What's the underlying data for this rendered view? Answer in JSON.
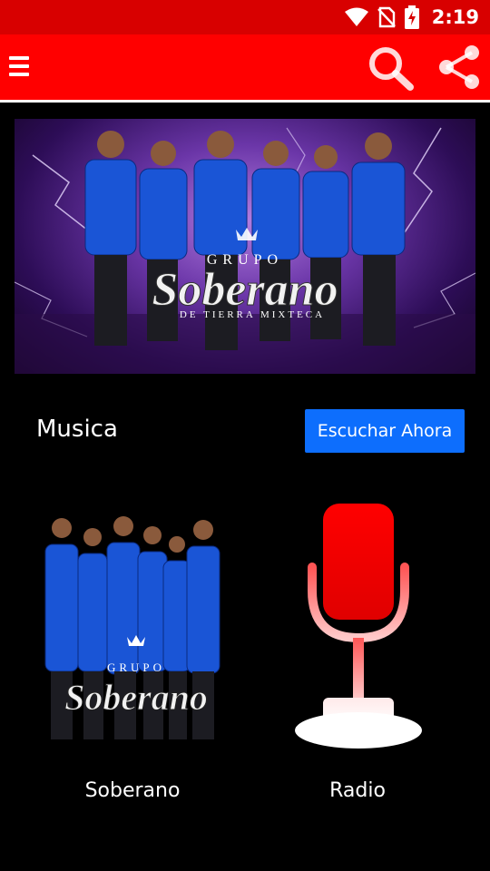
{
  "status_bar": {
    "time": "2:19"
  },
  "app_bar": {
    "menu_icon": "menu-icon",
    "search_icon": "search-icon",
    "share_icon": "share-icon",
    "background": "#ff0000"
  },
  "banner": {
    "logo_top": "GRUPO",
    "logo_main": "Soberano",
    "logo_sub": "DE TIERRA MIXTECA"
  },
  "section": {
    "title": "Musica",
    "button_label": "Escuchar Ahora",
    "button_color": "#0d6efd"
  },
  "tiles": [
    {
      "label": "Soberano",
      "logo_top": "GRUPO",
      "logo_main": "Soberano"
    },
    {
      "label": "Radio",
      "icon": "microphone-icon"
    }
  ]
}
